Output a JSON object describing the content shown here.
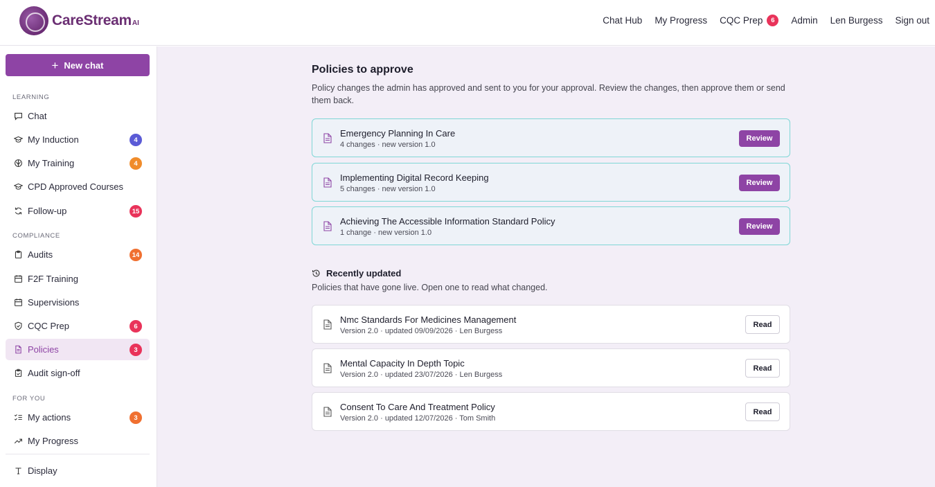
{
  "brand": {
    "name": "CareStream",
    "suffix": "AI"
  },
  "topnav": [
    {
      "label": "Chat Hub"
    },
    {
      "label": "My Progress"
    },
    {
      "label": "CQC Prep",
      "badge": "6"
    },
    {
      "label": "Admin"
    },
    {
      "label": "Len Burgess"
    },
    {
      "label": "Sign out"
    }
  ],
  "sidebar": {
    "new_chat": "New chat",
    "sections": {
      "learning": "LEARNING",
      "compliance": "COMPLIANCE",
      "for_you": "FOR YOU"
    },
    "items": [
      {
        "label": "Chat",
        "icon": "chat-bubble-icon"
      },
      {
        "label": "My Induction",
        "icon": "graduation-cap-icon",
        "badge": "4"
      },
      {
        "label": "My Training",
        "icon": "brain-icon",
        "badge": "4"
      },
      {
        "label": "CPD Approved Courses",
        "icon": "graduation-cap-icon"
      },
      {
        "label": "Follow-up",
        "icon": "refresh-icon",
        "badge": "15"
      },
      {
        "label": "Audits",
        "icon": "clipboard-icon",
        "badge": "14"
      },
      {
        "label": "F2F Training",
        "icon": "calendar-icon"
      },
      {
        "label": "Supervisions",
        "icon": "calendar-icon"
      },
      {
        "label": "CQC Prep",
        "icon": "shield-icon",
        "badge": "6"
      },
      {
        "label": "Policies",
        "icon": "document-icon",
        "badge": "3",
        "active": true
      },
      {
        "label": "Audit sign-off",
        "icon": "clipboard-check-icon"
      },
      {
        "label": "My actions",
        "icon": "checklist-icon",
        "badge": "3"
      },
      {
        "label": "My Progress",
        "icon": "trend-up-icon"
      },
      {
        "label": "Display",
        "icon": "text-type-icon"
      }
    ],
    "colors": {
      "accent": "#8e44a5",
      "badge_blue": "#5b5bd6",
      "badge_orange": "#f08c2b",
      "badge_red": "#e9335a"
    }
  },
  "main": {
    "title": "Policies to approve",
    "description": "Policy changes the admin has approved and sent to you for your approval. Review the changes, then approve them or send them back.",
    "pending": [
      {
        "title": "Emergency Planning In Care",
        "subtitle": "4 changes · new version 1.0",
        "action": "Review"
      },
      {
        "title": "Implementing Digital Record Keeping",
        "subtitle": "5 changes · new version 1.0",
        "action": "Review"
      },
      {
        "title": "Achieving The Accessible Information Standard Policy",
        "subtitle": "1 change · new version 1.0",
        "action": "Review"
      }
    ],
    "recent_title": "Recently updated",
    "recent_description": "Policies that have gone live. Open one to read what changed.",
    "recent": [
      {
        "title": "Nmc Standards For Medicines Management",
        "subtitle": "Version 2.0 · updated 09/09/2026 · Len Burgess",
        "action": "Read"
      },
      {
        "title": "Mental Capacity In Depth Topic",
        "subtitle": "Version 2.0 · updated 23/07/2026 · Len Burgess",
        "action": "Read"
      },
      {
        "title": "Consent To Care And Treatment Policy",
        "subtitle": "Version 2.0 · updated 12/07/2026 · Tom Smith",
        "action": "Read"
      }
    ]
  }
}
